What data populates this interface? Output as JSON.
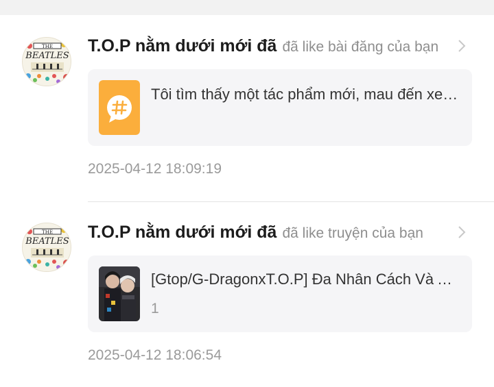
{
  "notifications": [
    {
      "avatar_icon": "beatles-avatar-icon",
      "user_name": "T.O.P nằm dưới mới đã",
      "action": "đã like bài đăng của bạn",
      "card": {
        "thumb_icon": "hashtag-topic-icon",
        "thumb_color": "#FBAE3C",
        "text": "Tôi tìm thấy một tác phẩm mới, mau đến xem nào",
        "subtext": ""
      },
      "timestamp": "2025-04-12 18:09:19"
    },
    {
      "avatar_icon": "beatles-avatar-icon",
      "user_name": "T.O.P nằm dưới mới đã",
      "action": "đã like truyện của bạn",
      "card": {
        "thumb_icon": "story-cover-image",
        "text": "[Gtop/G-DragonxT.O.P] Đa Nhân Cách Và Anh",
        "subtext": "1"
      },
      "timestamp": "2025-04-12 18:06:54"
    }
  ],
  "colors": {
    "name_text": "#1c1c1c",
    "secondary_text": "#8e8e8e",
    "card_bg": "#f5f5f7",
    "accent_orange": "#FBAE3C"
  }
}
